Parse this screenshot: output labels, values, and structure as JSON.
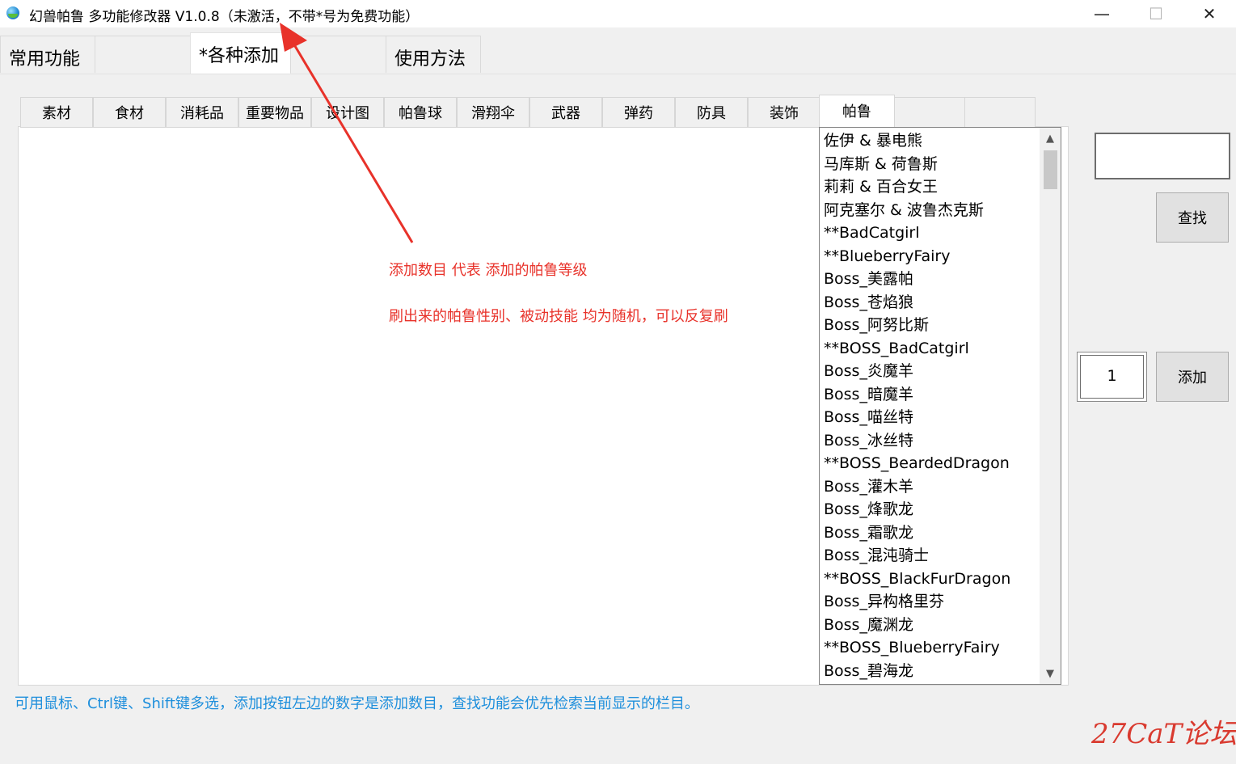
{
  "window": {
    "title": "幻兽帕鲁 多功能修改器  V1.0.8（未激活，不带*号为免费功能）",
    "minimize": "—",
    "maximize": "☐",
    "close": "✕"
  },
  "main_tabs": [
    {
      "label": "常用功能"
    },
    {
      "label": ""
    },
    {
      "label": "*各种添加"
    },
    {
      "label": ""
    },
    {
      "label": "使用方法"
    }
  ],
  "sub_tabs": [
    {
      "label": "素材"
    },
    {
      "label": "食材"
    },
    {
      "label": "消耗品"
    },
    {
      "label": "重要物品"
    },
    {
      "label": "设计图"
    },
    {
      "label": "帕鲁球"
    },
    {
      "label": "滑翔伞"
    },
    {
      "label": "武器"
    },
    {
      "label": "弹药"
    },
    {
      "label": "防具"
    },
    {
      "label": "装饰"
    },
    {
      "label": "帕鲁"
    },
    {
      "label": ""
    },
    {
      "label": ""
    }
  ],
  "list_items": [
    "佐伊 & 暴电熊",
    "马库斯 & 荷鲁斯",
    "莉莉 & 百合女王",
    "阿克塞尔 & 波鲁杰克斯",
    "**BadCatgirl",
    "**BlueberryFairy",
    "Boss_美露帕",
    "Boss_苍焰狼",
    "Boss_阿努比斯",
    "**BOSS_BadCatgirl",
    "Boss_炎魔羊",
    "Boss_暗魔羊",
    "Boss_喵丝特",
    "Boss_冰丝特",
    "**BOSS_BeardedDragon",
    "Boss_灌木羊",
    "Boss_烽歌龙",
    "Boss_霜歌龙",
    "Boss_混沌骑士",
    "**BOSS_BlackFurDragon",
    "Boss_异构格里芬",
    "Boss_魔渊龙",
    "**BOSS_BlueberryFairy",
    "Boss_碧海龙"
  ],
  "annotation": {
    "line1": "添加数目 代表 添加的帕鲁等级",
    "line2": "刷出来的帕鲁性别、被动技能 均为随机，可以反复刷"
  },
  "controls": {
    "search_value": "",
    "search_button": "查找",
    "quantity": "1",
    "add_button": "添加"
  },
  "hint": "可用鼠标、Ctrl键、Shift键多选，添加按钮左边的数字是添加数目，查找功能会优先检索当前显示的栏目。",
  "watermark": "27CaT论坛",
  "colors": {
    "annotation": "#e8322a",
    "hint": "#1e8fdc",
    "watermark": "#d93a2f"
  }
}
